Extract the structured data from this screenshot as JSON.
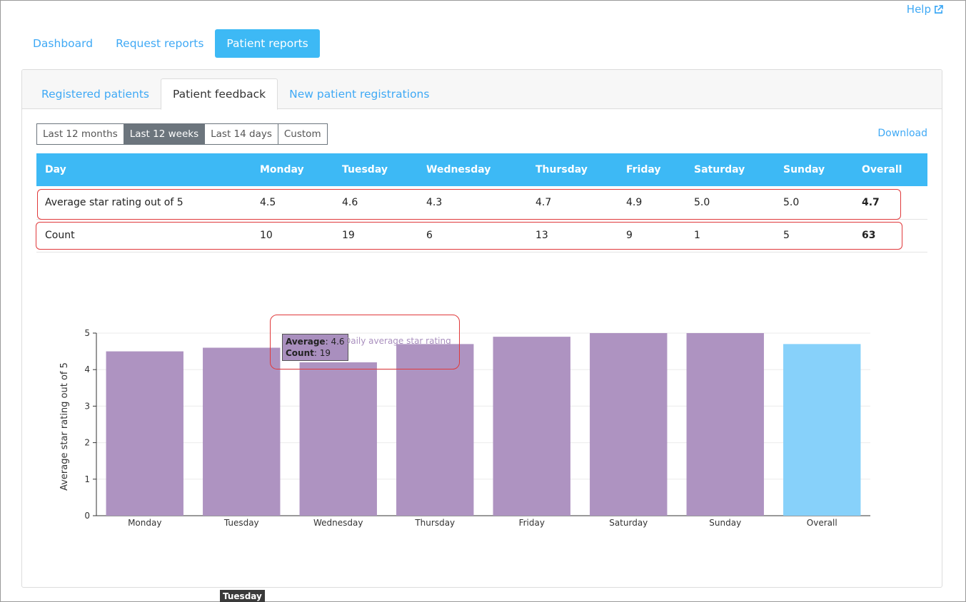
{
  "help": {
    "label": "Help"
  },
  "main_nav": [
    {
      "label": "Dashboard",
      "active": false
    },
    {
      "label": "Request reports",
      "active": false
    },
    {
      "label": "Patient reports",
      "active": true
    }
  ],
  "sub_tabs": [
    {
      "label": "Registered patients",
      "active": false
    },
    {
      "label": "Patient feedback",
      "active": true
    },
    {
      "label": "New patient registrations",
      "active": false
    }
  ],
  "range_options": [
    {
      "label": "Last 12 months",
      "active": false
    },
    {
      "label": "Last 12 weeks",
      "active": true
    },
    {
      "label": "Last 14 days",
      "active": false
    },
    {
      "label": "Custom",
      "active": false
    }
  ],
  "download": {
    "label": "Download"
  },
  "table": {
    "headers": [
      "Day",
      "Monday",
      "Tuesday",
      "Wednesday",
      "Thursday",
      "Friday",
      "Saturday",
      "Sunday",
      "Overall"
    ],
    "rows": [
      [
        "Average star rating out of 5",
        "4.5",
        "4.6",
        "4.3",
        "4.7",
        "4.9",
        "5.0",
        "5.0",
        "4.7"
      ],
      [
        "Count",
        "10",
        "19",
        "6",
        "13",
        "9",
        "1",
        "5",
        "63"
      ]
    ]
  },
  "tooltip": {
    "avg_label": "Average",
    "avg_value": "4.6",
    "count_label": "Count",
    "count_value": "19",
    "series_label": "Daily average star rating",
    "x_label": "Tuesday"
  },
  "colors": {
    "accent": "#3db9f5",
    "bar": "#ae93c1",
    "overall_bar": "#87d1fa",
    "highlight": "#e0393b"
  },
  "chart_data": {
    "type": "bar",
    "categories": [
      "Monday",
      "Tuesday",
      "Wednesday",
      "Thursday",
      "Friday",
      "Saturday",
      "Sunday",
      "Overall"
    ],
    "values": [
      4.5,
      4.6,
      4.2,
      4.7,
      4.9,
      5.0,
      5.0,
      4.7
    ],
    "ylabel": "Average star rating out of 5",
    "ylim": [
      0,
      5
    ],
    "yticks": [
      0,
      1,
      2,
      3,
      4,
      5
    ],
    "grid": true
  }
}
